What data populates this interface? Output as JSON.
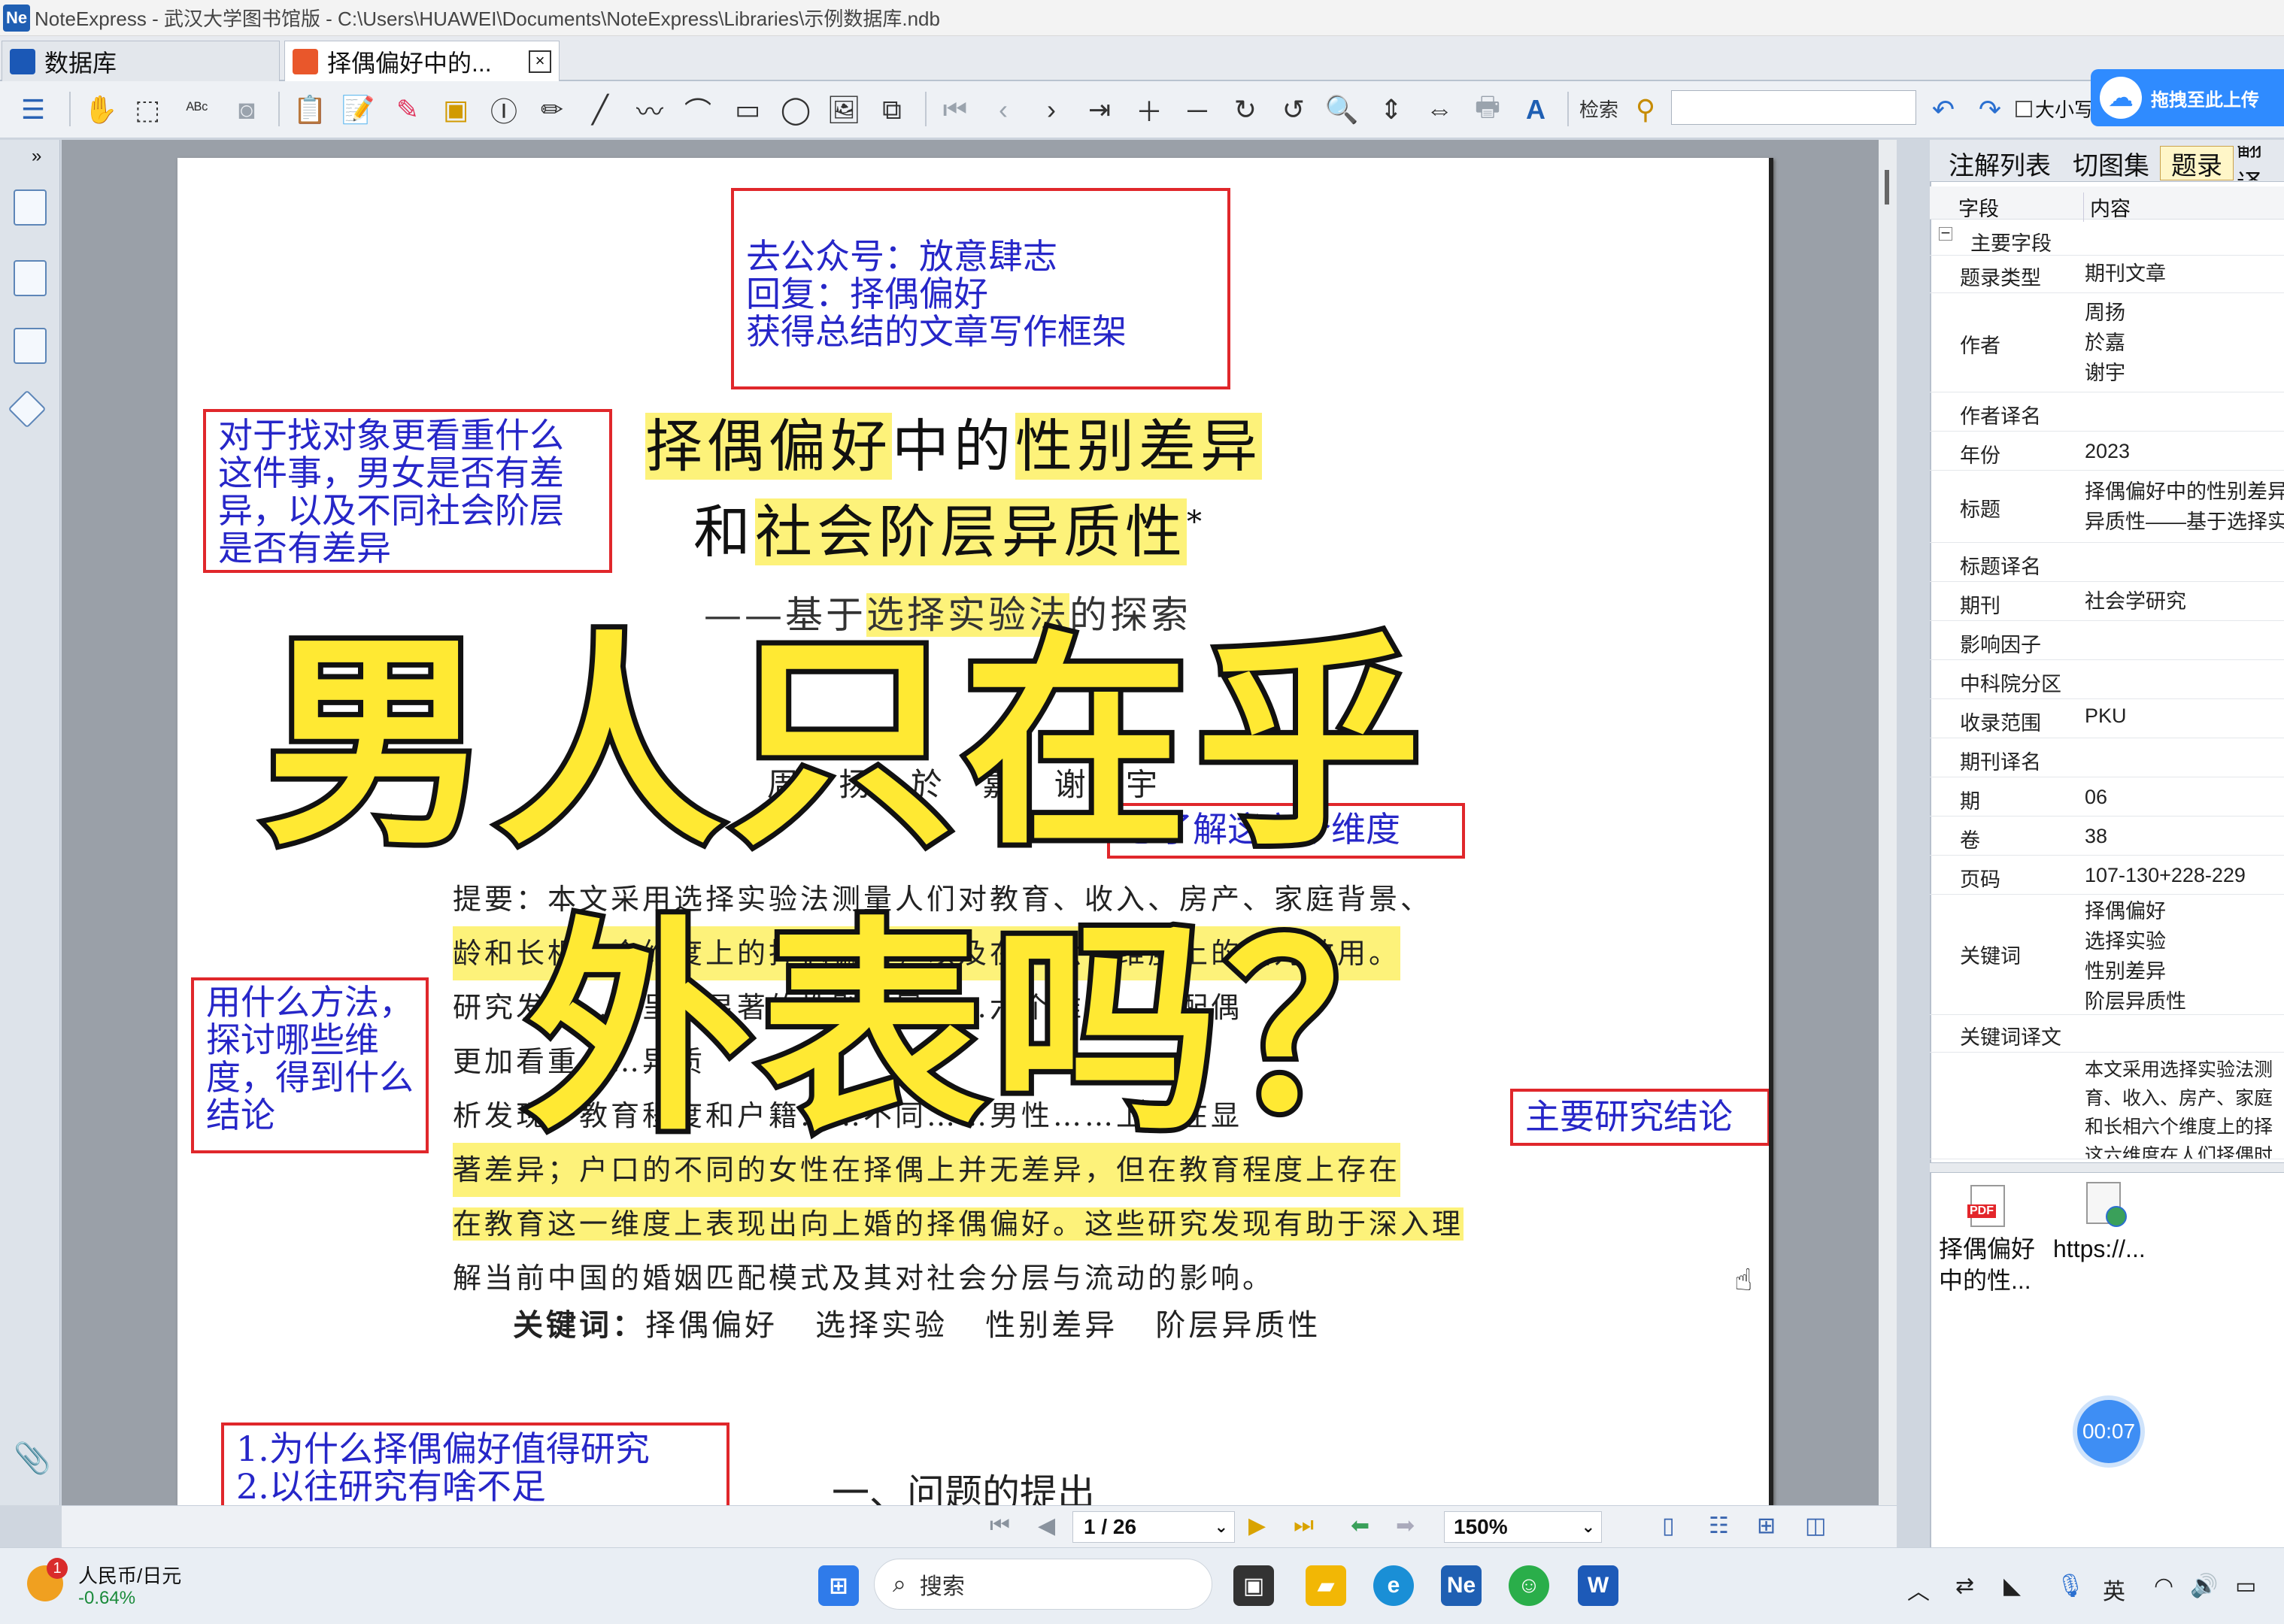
{
  "window": {
    "title": "NoteExpress - 武汉大学图书馆版 - C:\\Users\\HUAWEI\\Documents\\NoteExpress\\Libraries\\示例数据库.ndb",
    "logo": "Ne"
  },
  "tabs": [
    {
      "label": "数据库",
      "icon": "database-icon"
    },
    {
      "label": "择偶偏好中的...",
      "icon": "pdf-icon",
      "close": "×"
    }
  ],
  "toolbar": {
    "search_label": "检索",
    "search_value": "",
    "size_label": "大小写",
    "upload_label": "拖拽至此上传"
  },
  "document": {
    "note_top": [
      "去公众号：放意肆志",
      "回复：择偶偏好",
      "获得总结的文章写作框架"
    ],
    "note_left_top": [
      "对于找对象更看重什么",
      "这件事，男女是否有差",
      "异，以及不同社会阶层",
      "是否有差异"
    ],
    "title_line1": [
      "择偶偏好",
      "中的",
      "性别差异"
    ],
    "title_line2": [
      "和",
      "社会阶层异质性",
      "*"
    ],
    "subtitle": [
      "——基于",
      "选择实验法",
      "的探索"
    ],
    "authors": "周    扬    於    嘉    谢    宇",
    "note_six": "想了解这六个维度",
    "abstract_lines": [
      "提要：本文采用选择实验法测量人们对教育、收入、房产、家庭背景、",
      "龄和长相六个维度上的择偶偏好，以及在这六个维度上的相对效用。",
      "研究发现……呈现显著的性别差异……六个维度……配偶",
      "更加看重……异质",
      "析发现，教育程度和户籍……不同……男性……上存在显",
      "著差异；户口的不同的女性在择偶上并无差异，但在教育程度上存在",
      "在教育这一维度上表现出向上婚的择偶偏好。这些研究发现有助于深入理",
      "解当前中国的婚姻匹配模式及其对社会分层与流动的影响。"
    ],
    "keywords_label": "关键词：",
    "keywords": "择偶偏好   选择实验   性别差异   阶层异质性",
    "note_left_mid": [
      "用什么方法，",
      "探讨哪些维",
      "度，得到什么",
      "结论"
    ],
    "note_right_mid": "主要研究结论",
    "note_bottom": [
      "1.为什么择偶偏好值得研究",
      "2.以往研究有啥不足"
    ],
    "section_heading": "一、问题的提出"
  },
  "overlay": {
    "line1": "男人只在乎",
    "line2": "外表吗？"
  },
  "right_panel": {
    "tabs": [
      "注解列表",
      "切图集",
      "题录",
      "翻译"
    ],
    "active_tab": "题录",
    "header": {
      "field": "字段",
      "content": "内容"
    },
    "group": "主要字段",
    "fields": [
      {
        "k": "题录类型",
        "v": "期刊文章"
      },
      {
        "k": "作者",
        "v": "周扬\n於嘉\n谢宇"
      },
      {
        "k": "作者译名",
        "v": ""
      },
      {
        "k": "年份",
        "v": "2023"
      },
      {
        "k": "标题",
        "v": "择偶偏好中的性别差异\n异质性——基于选择实"
      },
      {
        "k": "标题译名",
        "v": ""
      },
      {
        "k": "期刊",
        "v": "社会学研究"
      },
      {
        "k": "影响因子",
        "v": ""
      },
      {
        "k": "中科院分区",
        "v": ""
      },
      {
        "k": "收录范围",
        "v": "PKU"
      },
      {
        "k": "期刊译名",
        "v": ""
      },
      {
        "k": "期",
        "v": "06"
      },
      {
        "k": "卷",
        "v": "38"
      },
      {
        "k": "页码",
        "v": "107-130+228-229"
      },
      {
        "k": "关键词",
        "v": "择偶偏好\n选择实验\n性别差异\n阶层异质性"
      },
      {
        "k": "关键词译文",
        "v": ""
      },
      {
        "k": "",
        "v": "本文采用选择实验法测\n育、收入、房产、家庭\n和长相六个维度上的择\n这六维度在人们择偶时"
      }
    ],
    "attachments": [
      {
        "label": "择偶偏好\n中的性...",
        "icon": "pdf-icon"
      },
      {
        "label": "https://...",
        "icon": "web-link-icon"
      }
    ],
    "timer": "00:07"
  },
  "page_nav": {
    "page": "1 / 26",
    "zoom": "150%"
  },
  "taskbar": {
    "stock_name": "人民币/日元",
    "stock_change": "-0.64%",
    "badge": "1",
    "search_placeholder": "搜索",
    "ime": "英"
  }
}
